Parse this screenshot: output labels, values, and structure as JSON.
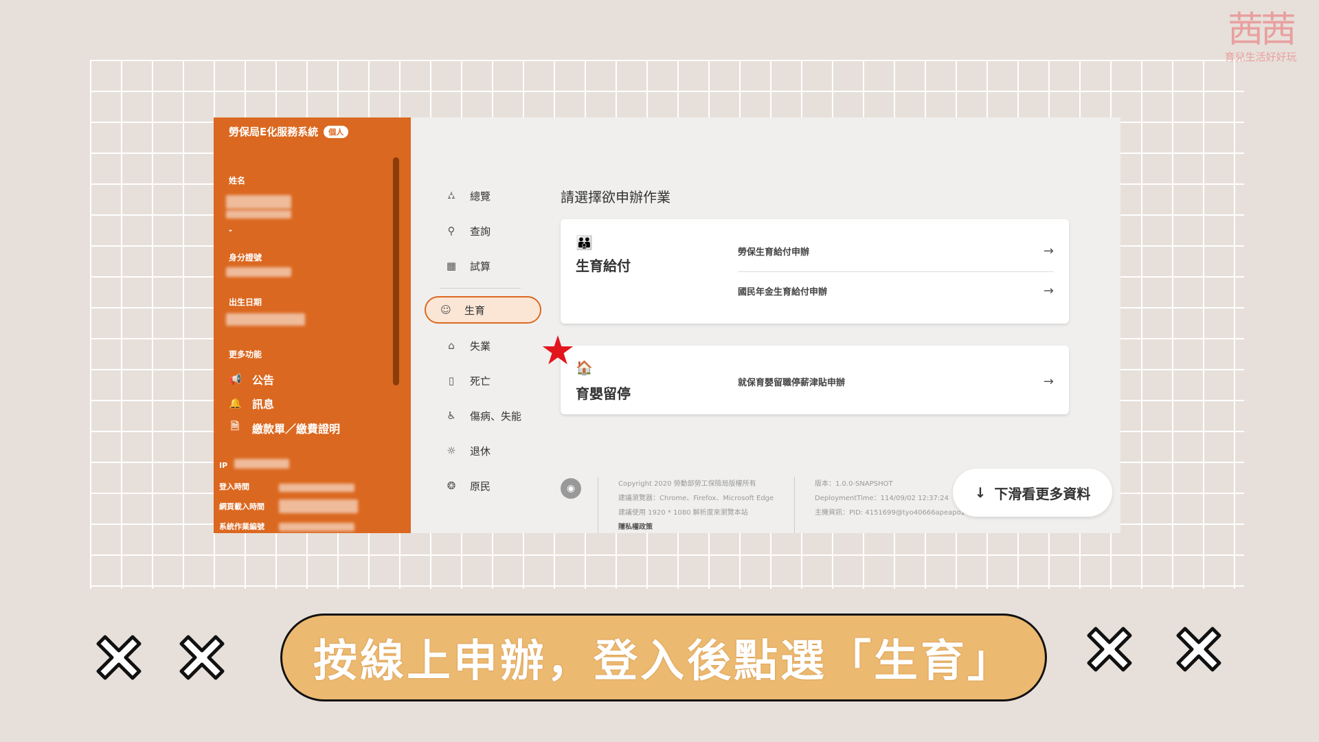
{
  "logo": {
    "mark": "茜茜",
    "tagline": "育兒生活好好玩"
  },
  "sidebar": {
    "title": "勞保局E化服務系統",
    "badge": "個人",
    "name_label": "姓名",
    "name_dash": "-",
    "id_label": "身分證號",
    "birth_label": "出生日期",
    "more_label": "更多功能",
    "functions": [
      {
        "label": "公告",
        "icon": "megaphone-icon"
      },
      {
        "label": "訊息",
        "icon": "bell-icon"
      },
      {
        "label": "繳款單／繳費證明",
        "icon": "document-icon"
      }
    ],
    "info": {
      "ip": "IP",
      "login_time": "登入時間",
      "page_load_time": "網頁載入時間",
      "system_id": "系統作業編號"
    }
  },
  "nav": [
    {
      "label": "總覽",
      "icon": "overview-icon",
      "glyph": "⛼"
    },
    {
      "label": "查詢",
      "icon": "search-icon",
      "glyph": "⚲"
    },
    {
      "label": "試算",
      "icon": "calculator-icon",
      "glyph": "▦"
    },
    {
      "label": "生育",
      "icon": "baby-icon",
      "glyph": "☺",
      "active": true
    },
    {
      "label": "失業",
      "icon": "unemployment-icon",
      "glyph": "⌂"
    },
    {
      "label": "死亡",
      "icon": "death-icon",
      "glyph": "▯"
    },
    {
      "label": "傷病、失能",
      "icon": "injury-icon",
      "glyph": "♿"
    },
    {
      "label": "退休",
      "icon": "retirement-icon",
      "glyph": "☼"
    },
    {
      "label": "原民",
      "icon": "aboriginal-icon",
      "glyph": "❂"
    }
  ],
  "main": {
    "title": "請選擇欲申辦作業",
    "cards": [
      {
        "title": "生育給付",
        "links": [
          "勞保生育給付申辦",
          "國民年金生育給付申辦"
        ]
      },
      {
        "title": "育嬰留停",
        "links": [
          "就保育嬰留職停薪津貼申辦"
        ]
      }
    ],
    "footer": {
      "copyright": "Copyright 2020 勞動部勞工保險局版權所有",
      "browser": "建議瀏覽器：Chrome、Firefox、Microsoft Edge",
      "resolution": "建議使用 1920 * 1080 解析度來瀏覽本站",
      "privacy": "隱私權政策",
      "version": "版本：1.0.0-SNAPSHOT",
      "deployment": "DeploymentTime：114/09/02 12:37:24",
      "host": "主機資訊：PID: 4151699@tyo40666apeapo2"
    }
  },
  "scroll_hint": {
    "arrow": "↓",
    "label": "下滑看更多資料"
  },
  "caption": "按線上申辦，登入後點選「生育」",
  "colors": {
    "accent": "#db6820",
    "background": "#e7e0da",
    "caption_fill": "#ecb971",
    "star": "#e2141c"
  }
}
